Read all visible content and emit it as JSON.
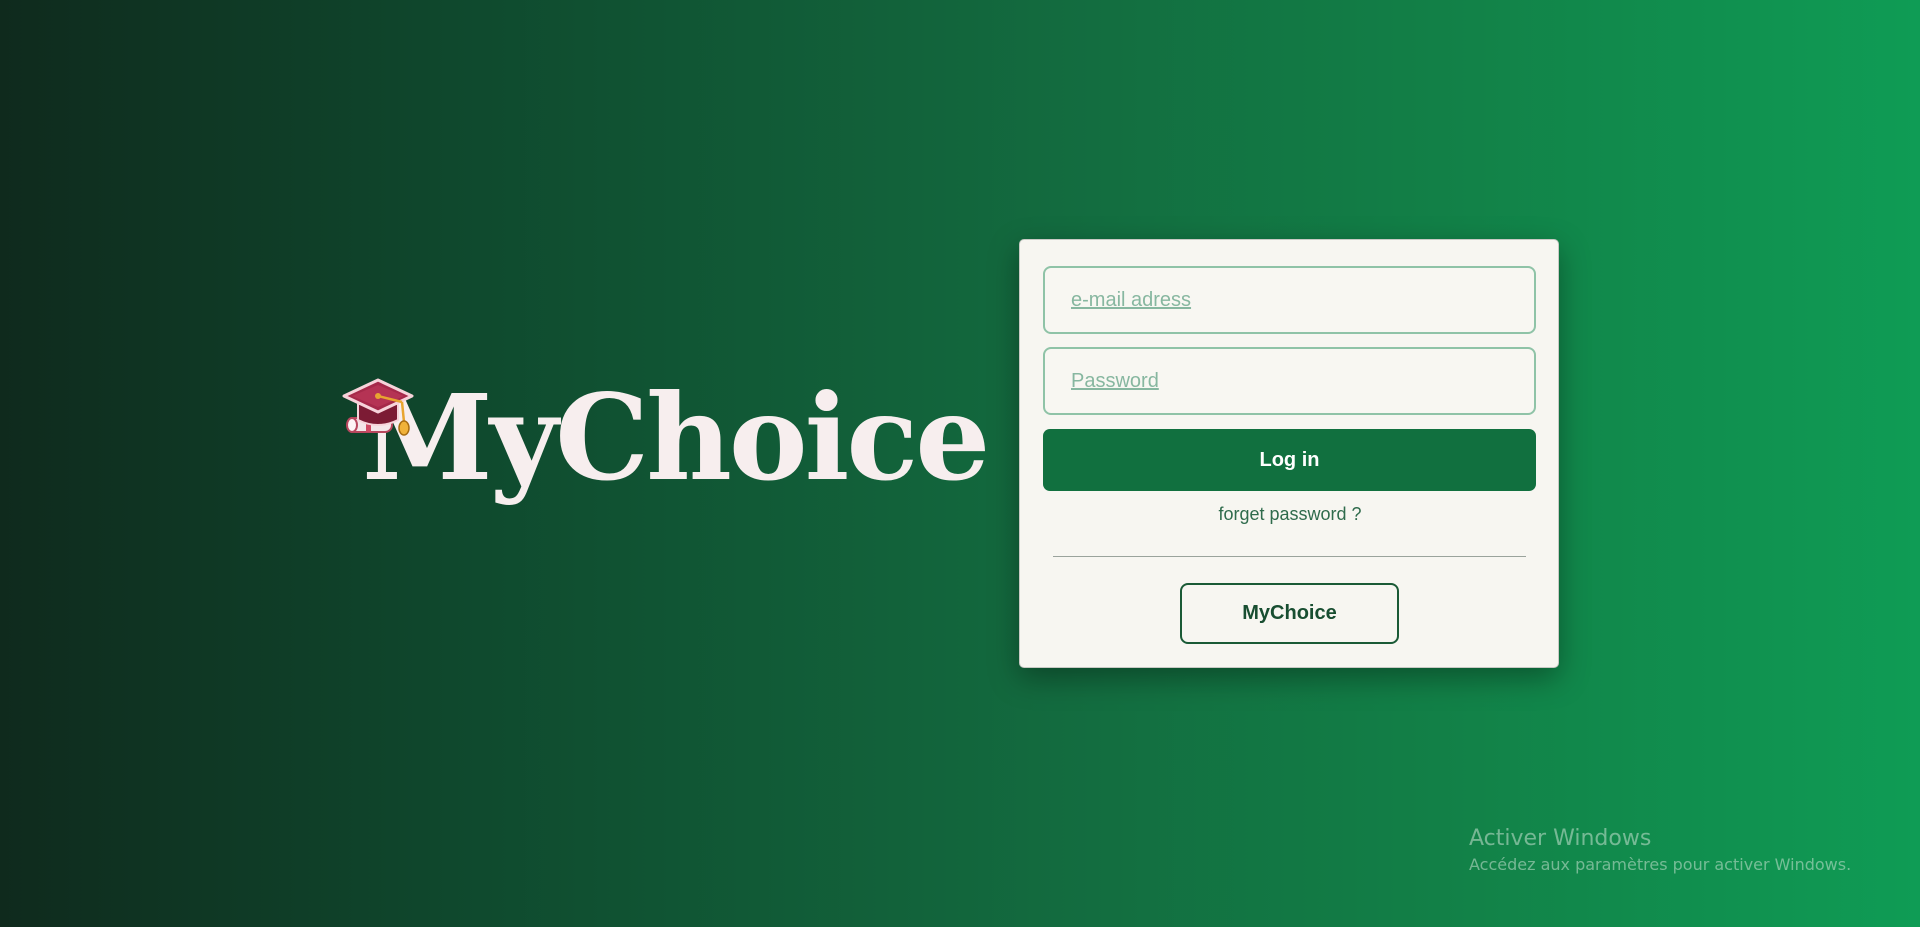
{
  "brand": {
    "title": "MyChoice",
    "logo_icon": "graduation-cap-icon",
    "title_color": "#f7eeee"
  },
  "login_form": {
    "email_placeholder": "e-mail adress",
    "email_value": "",
    "password_placeholder": "Password",
    "password_value": "",
    "login_label": "Log in",
    "forgot_password_label": "forget password ?",
    "secondary_label": "MyChoice"
  },
  "watermark": {
    "title": "Activer Windows",
    "subtitle": "Accédez aux paramètres pour activer Windows."
  },
  "colors": {
    "accent": "#11703f",
    "card_background": "#f7f6f1",
    "field_border": "#8fc3a7",
    "background_dark": "#0f2a1d",
    "background_light": "#0f9c55"
  }
}
